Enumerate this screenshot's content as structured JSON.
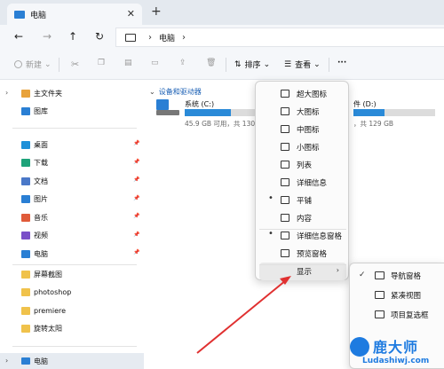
{
  "window": {
    "tab_title": "电脑",
    "tab_close": "✕",
    "new_tab": "+"
  },
  "nav": {
    "back": "←",
    "forward": "→",
    "up": "↑",
    "refresh": "↻",
    "breadcrumb_sep": "›",
    "breadcrumb": "电脑",
    "breadcrumb_end": "›"
  },
  "toolbar": {
    "new_label": "新建",
    "sort_label": "排序",
    "view_label": "查看",
    "more_label": "···"
  },
  "sidebar": {
    "home": "主文件夹",
    "gallery": "图库",
    "pinned": [
      {
        "label": "桌面",
        "color": "#1e90d8"
      },
      {
        "label": "下载",
        "color": "#1ea37a"
      },
      {
        "label": "文档",
        "color": "#4a78c8"
      },
      {
        "label": "图片",
        "color": "#2a7fd4"
      },
      {
        "label": "音乐",
        "color": "#e05b3a"
      },
      {
        "label": "视频",
        "color": "#7a4fc8"
      },
      {
        "label": "电脑",
        "color": "#2a7fd4"
      }
    ],
    "folders": [
      "屏幕截图",
      "photoshop",
      "premiere",
      "旋转太阳"
    ],
    "this_pc": "电脑"
  },
  "main": {
    "group_header": "设备和驱动器",
    "drives": [
      {
        "name": "系统 (C:)",
        "free_text": "45.9 GB 可用，共 130",
        "usage": 0.65
      },
      {
        "name": "件 (D:)",
        "free_text": "，共 129 GB",
        "usage": 0.38
      }
    ]
  },
  "view_menu": {
    "items": [
      {
        "label": "超大图标",
        "selected": false
      },
      {
        "label": "大图标",
        "selected": false
      },
      {
        "label": "中图标",
        "selected": false
      },
      {
        "label": "小图标",
        "selected": false
      },
      {
        "label": "列表",
        "selected": false
      },
      {
        "label": "详细信息",
        "selected": false
      },
      {
        "label": "平铺",
        "selected": true
      },
      {
        "label": "内容",
        "selected": false
      }
    ],
    "pane_items": [
      {
        "label": "详细信息窗格",
        "selected": true
      },
      {
        "label": "预览窗格",
        "selected": false
      }
    ],
    "show_label": "显示",
    "show_arrow": "›"
  },
  "show_submenu": {
    "items": [
      {
        "label": "导航窗格",
        "checked": true
      },
      {
        "label": "紧凑视图",
        "checked": false
      },
      {
        "label": "项目复选框",
        "checked": false
      }
    ]
  },
  "watermark": {
    "title": "鹿大师",
    "url": "Ludashiwj.com"
  },
  "colors": {
    "accent": "#2a8ad8",
    "arrow": "#e03030",
    "watermark": "#1e7be0"
  }
}
